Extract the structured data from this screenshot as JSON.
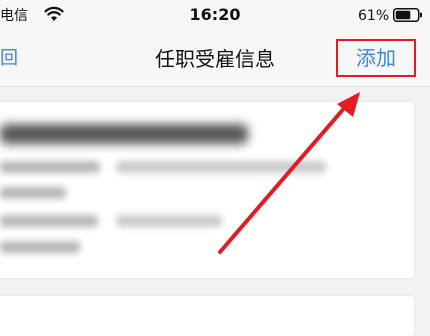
{
  "status_bar": {
    "carrier": "电信",
    "time": "16:20",
    "battery_percent": "61%",
    "icons": [
      "wifi-icon",
      "battery-icon"
    ]
  },
  "nav": {
    "back_label": "回",
    "title": "任职受雇信息",
    "add_label": "添加"
  },
  "colors": {
    "accent": "#3a86d8",
    "highlight": "#e31b23",
    "background": "#f2f2f4"
  }
}
